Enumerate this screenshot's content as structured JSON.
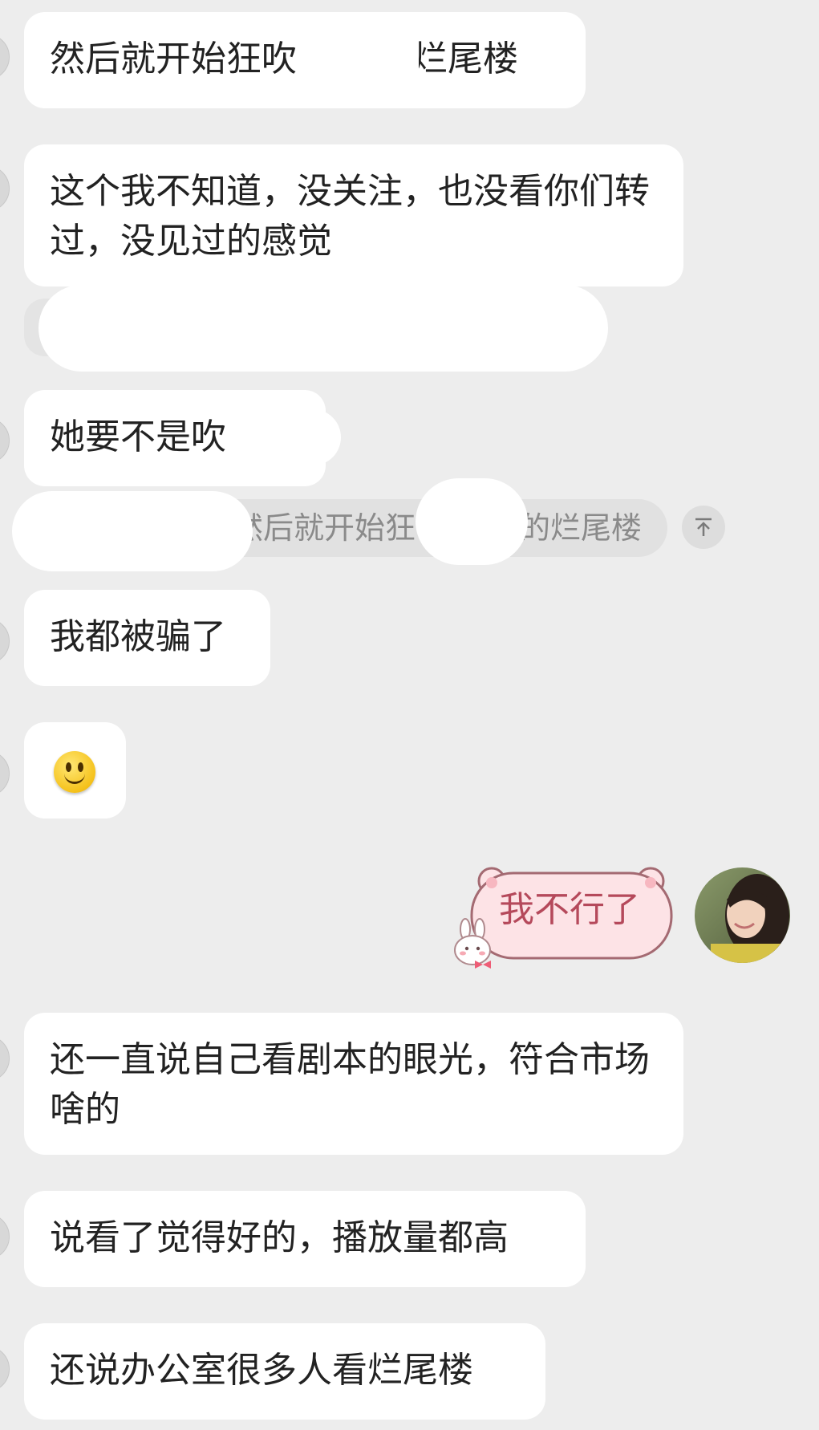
{
  "messages": [
    {
      "text": "然后就开始狂吹",
      "text_tail": "的烂尾楼"
    },
    {
      "text": "这个我不知道，没关注，也没看你们转过，没见过的感觉"
    },
    {
      "text": "她要不是吹"
    },
    {
      "text": "我都被骗了"
    },
    {
      "text": "还一直说自己看剧本的眼光，符合市场啥的"
    },
    {
      "text": "说看了觉得好的，播放量都高"
    },
    {
      "text": "还说办公室很多人看烂尾楼"
    }
  ],
  "quote": {
    "text": "然后就开始狂",
    "text_tail": "的烂尾楼",
    "jump_icon": "arrow-up-to-line-icon"
  },
  "emoji": {
    "name": "smile-emoji-icon"
  },
  "self_message": {
    "text": "我不行了",
    "sticker_icon": "bunny-sticker-icon"
  },
  "colors": {
    "background": "#ededed",
    "bubble": "#ffffff",
    "quote_bg": "#e1e1e1",
    "cute_bubble_fill": "#fde3e6",
    "cute_bubble_border": "#a46a72",
    "cute_text": "#b5495b"
  }
}
